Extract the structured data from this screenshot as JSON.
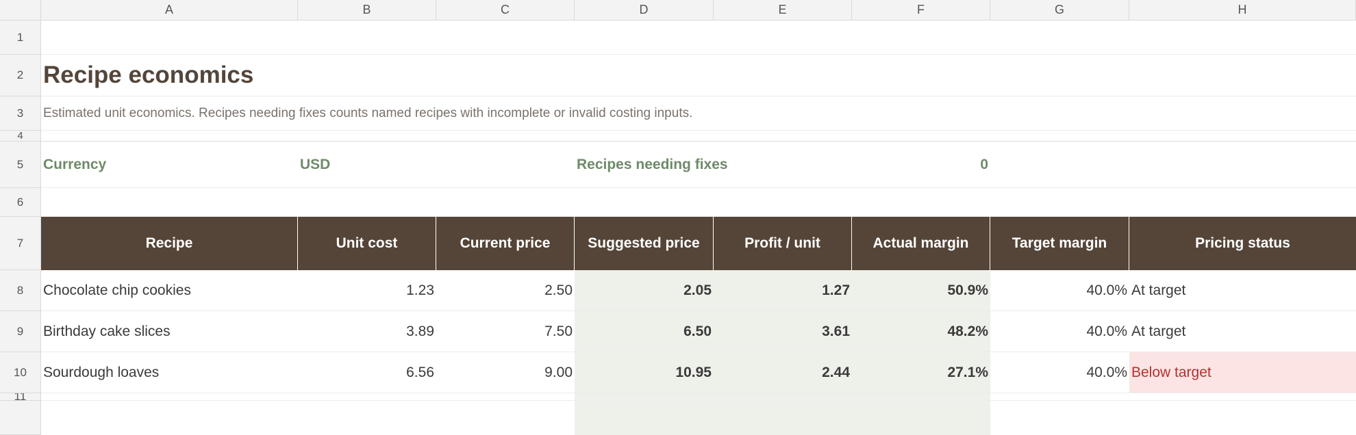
{
  "columns": [
    "A",
    "B",
    "C",
    "D",
    "E",
    "F",
    "G",
    "H"
  ],
  "rows": [
    "1",
    "2",
    "3",
    "4",
    "5",
    "6",
    "7",
    "8",
    "9",
    "10",
    "11"
  ],
  "title": "Recipe economics",
  "subtitle": "Estimated unit economics. Recipes needing fixes counts named recipes with incomplete or invalid costing inputs.",
  "summary": {
    "currency_label": "Currency",
    "currency_value": "USD",
    "fixes_label": "Recipes needing fixes",
    "fixes_value": "0"
  },
  "table": {
    "headers": [
      "Recipe",
      "Unit cost",
      "Current price",
      "Suggested price",
      "Profit / unit",
      "Actual margin",
      "Target margin",
      "Pricing status"
    ],
    "rows": [
      [
        "Chocolate chip cookies",
        "1.23",
        "2.50",
        "2.05",
        "1.27",
        "50.9%",
        "40.0%",
        "At target"
      ],
      [
        "Birthday cake slices",
        "3.89",
        "7.50",
        "6.50",
        "3.61",
        "48.2%",
        "40.0%",
        "At target"
      ],
      [
        "Sourdough loaves",
        "6.56",
        "9.00",
        "10.95",
        "2.44",
        "27.1%",
        "40.0%",
        "Below target"
      ]
    ]
  },
  "colors": {
    "header_bg": "#544538",
    "title": "#54453a",
    "label_green": "#6f8a6a",
    "computed_shade": "#eef0ea",
    "below_bg": "#fce4e4",
    "below_text": "#b3312f"
  }
}
